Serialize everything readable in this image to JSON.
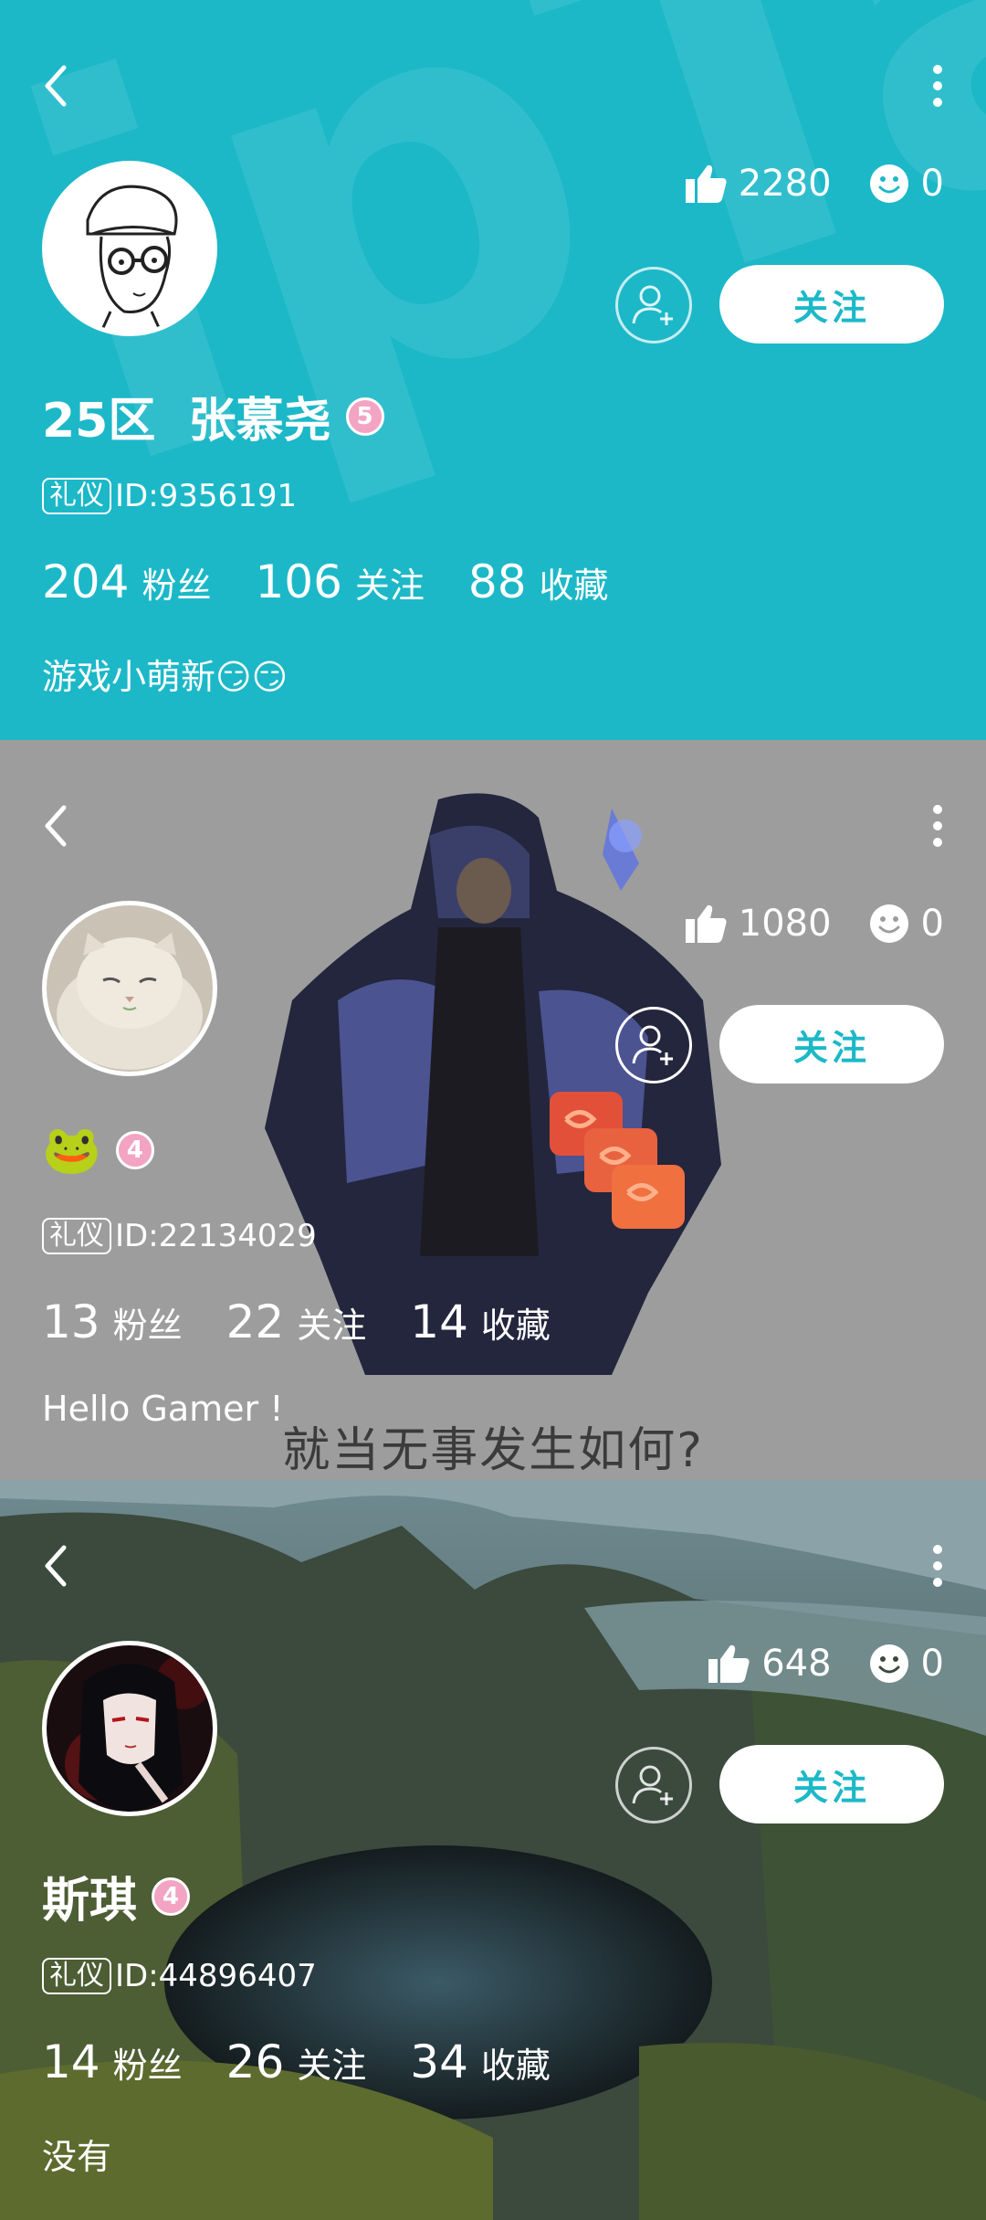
{
  "colors": {
    "accent": "#1cb8c8",
    "level_badge": "#f2a4c2"
  },
  "panels": [
    {
      "likes": "2280",
      "smiles": "0",
      "follow_label": "关注",
      "name": "25区  张慕尧",
      "level": "5",
      "tag": "礼仪",
      "id": "ID:9356191",
      "fans_count": "204",
      "fans_label": "粉丝",
      "following_count": "106",
      "following_label": "关注",
      "favorites_count": "88",
      "favorites_label": "收藏",
      "bio": "游戏小萌新😏😏"
    },
    {
      "likes": "1080",
      "smiles": "0",
      "follow_label": "关注",
      "name": "🐸",
      "level": "4",
      "tag": "礼仪",
      "id": "ID:22134029",
      "fans_count": "13",
      "fans_label": "粉丝",
      "following_count": "22",
      "following_label": "关注",
      "favorites_count": "14",
      "favorites_label": "收藏",
      "bio": "Hello Gamer !",
      "background_caption": "就当无事发生如何?"
    },
    {
      "likes": "648",
      "smiles": "0",
      "follow_label": "关注",
      "name": "斯琪",
      "level": "4",
      "tag": "礼仪",
      "id": "ID:44896407",
      "fans_count": "14",
      "fans_label": "粉丝",
      "following_count": "26",
      "following_label": "关注",
      "favorites_count": "34",
      "favorites_label": "收藏",
      "bio": "没有"
    }
  ]
}
